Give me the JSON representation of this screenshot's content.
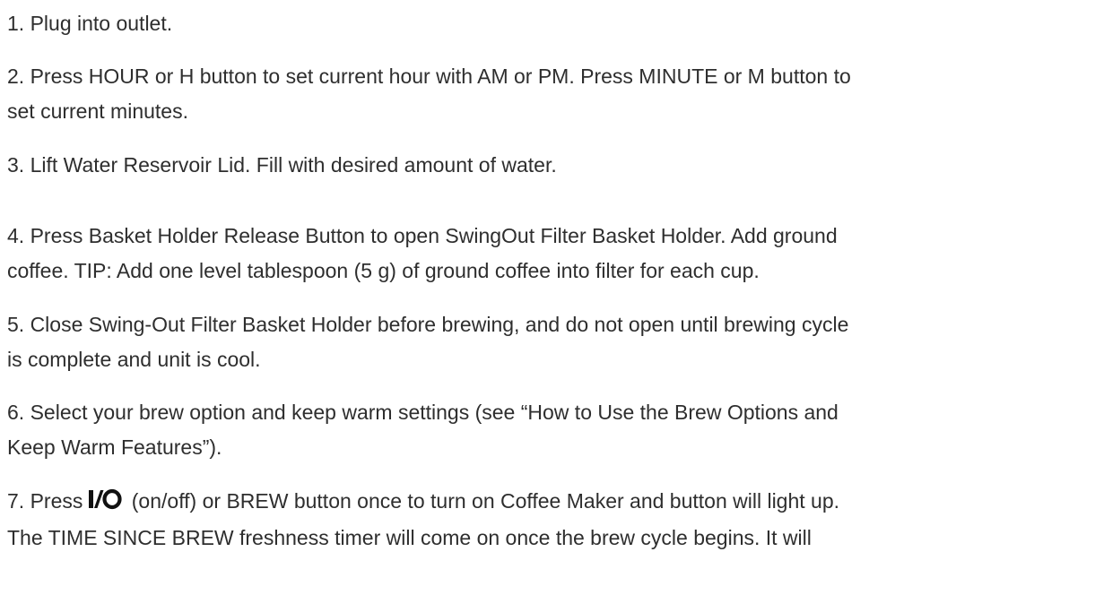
{
  "steps": [
    {
      "lines": [
        "1. Plug into outlet."
      ]
    },
    {
      "lines": [
        "2. Press HOUR or H button to set current hour with AM or PM. Press MINUTE or M button to",
        "set current minutes."
      ]
    },
    {
      "lines": [
        "3. Lift Water Reservoir Lid. Fill with desired amount of water."
      ]
    },
    {
      "lines": [
        "4. Press Basket Holder Release Button to open SwingOut Filter Basket Holder. Add ground",
        "coffee. TIP: Add one level tablespoon (5 g) of ground coffee into filter for each cup."
      ]
    },
    {
      "lines": [
        "5. Close Swing-Out Filter Basket Holder before brewing, and do not open until brewing cycle",
        "is complete and unit is cool."
      ]
    },
    {
      "lines": [
        "6. Select your brew option and keep warm settings (see “How to Use the Brew Options and",
        "Keep Warm Features”)."
      ]
    },
    {
      "line1_prefix": "7. Press",
      "line1_suffix": " (on/off) or BREW button once to turn on Coffee Maker and button will light up.",
      "line2": "The TIME SINCE BREW freshness timer will come on once the brew cycle begins. It will",
      "icon": "power-io-icon",
      "icon_label": "I/O"
    }
  ],
  "colors": {
    "text": "#2e2e2e",
    "icon": "#111111",
    "background": "#ffffff"
  }
}
